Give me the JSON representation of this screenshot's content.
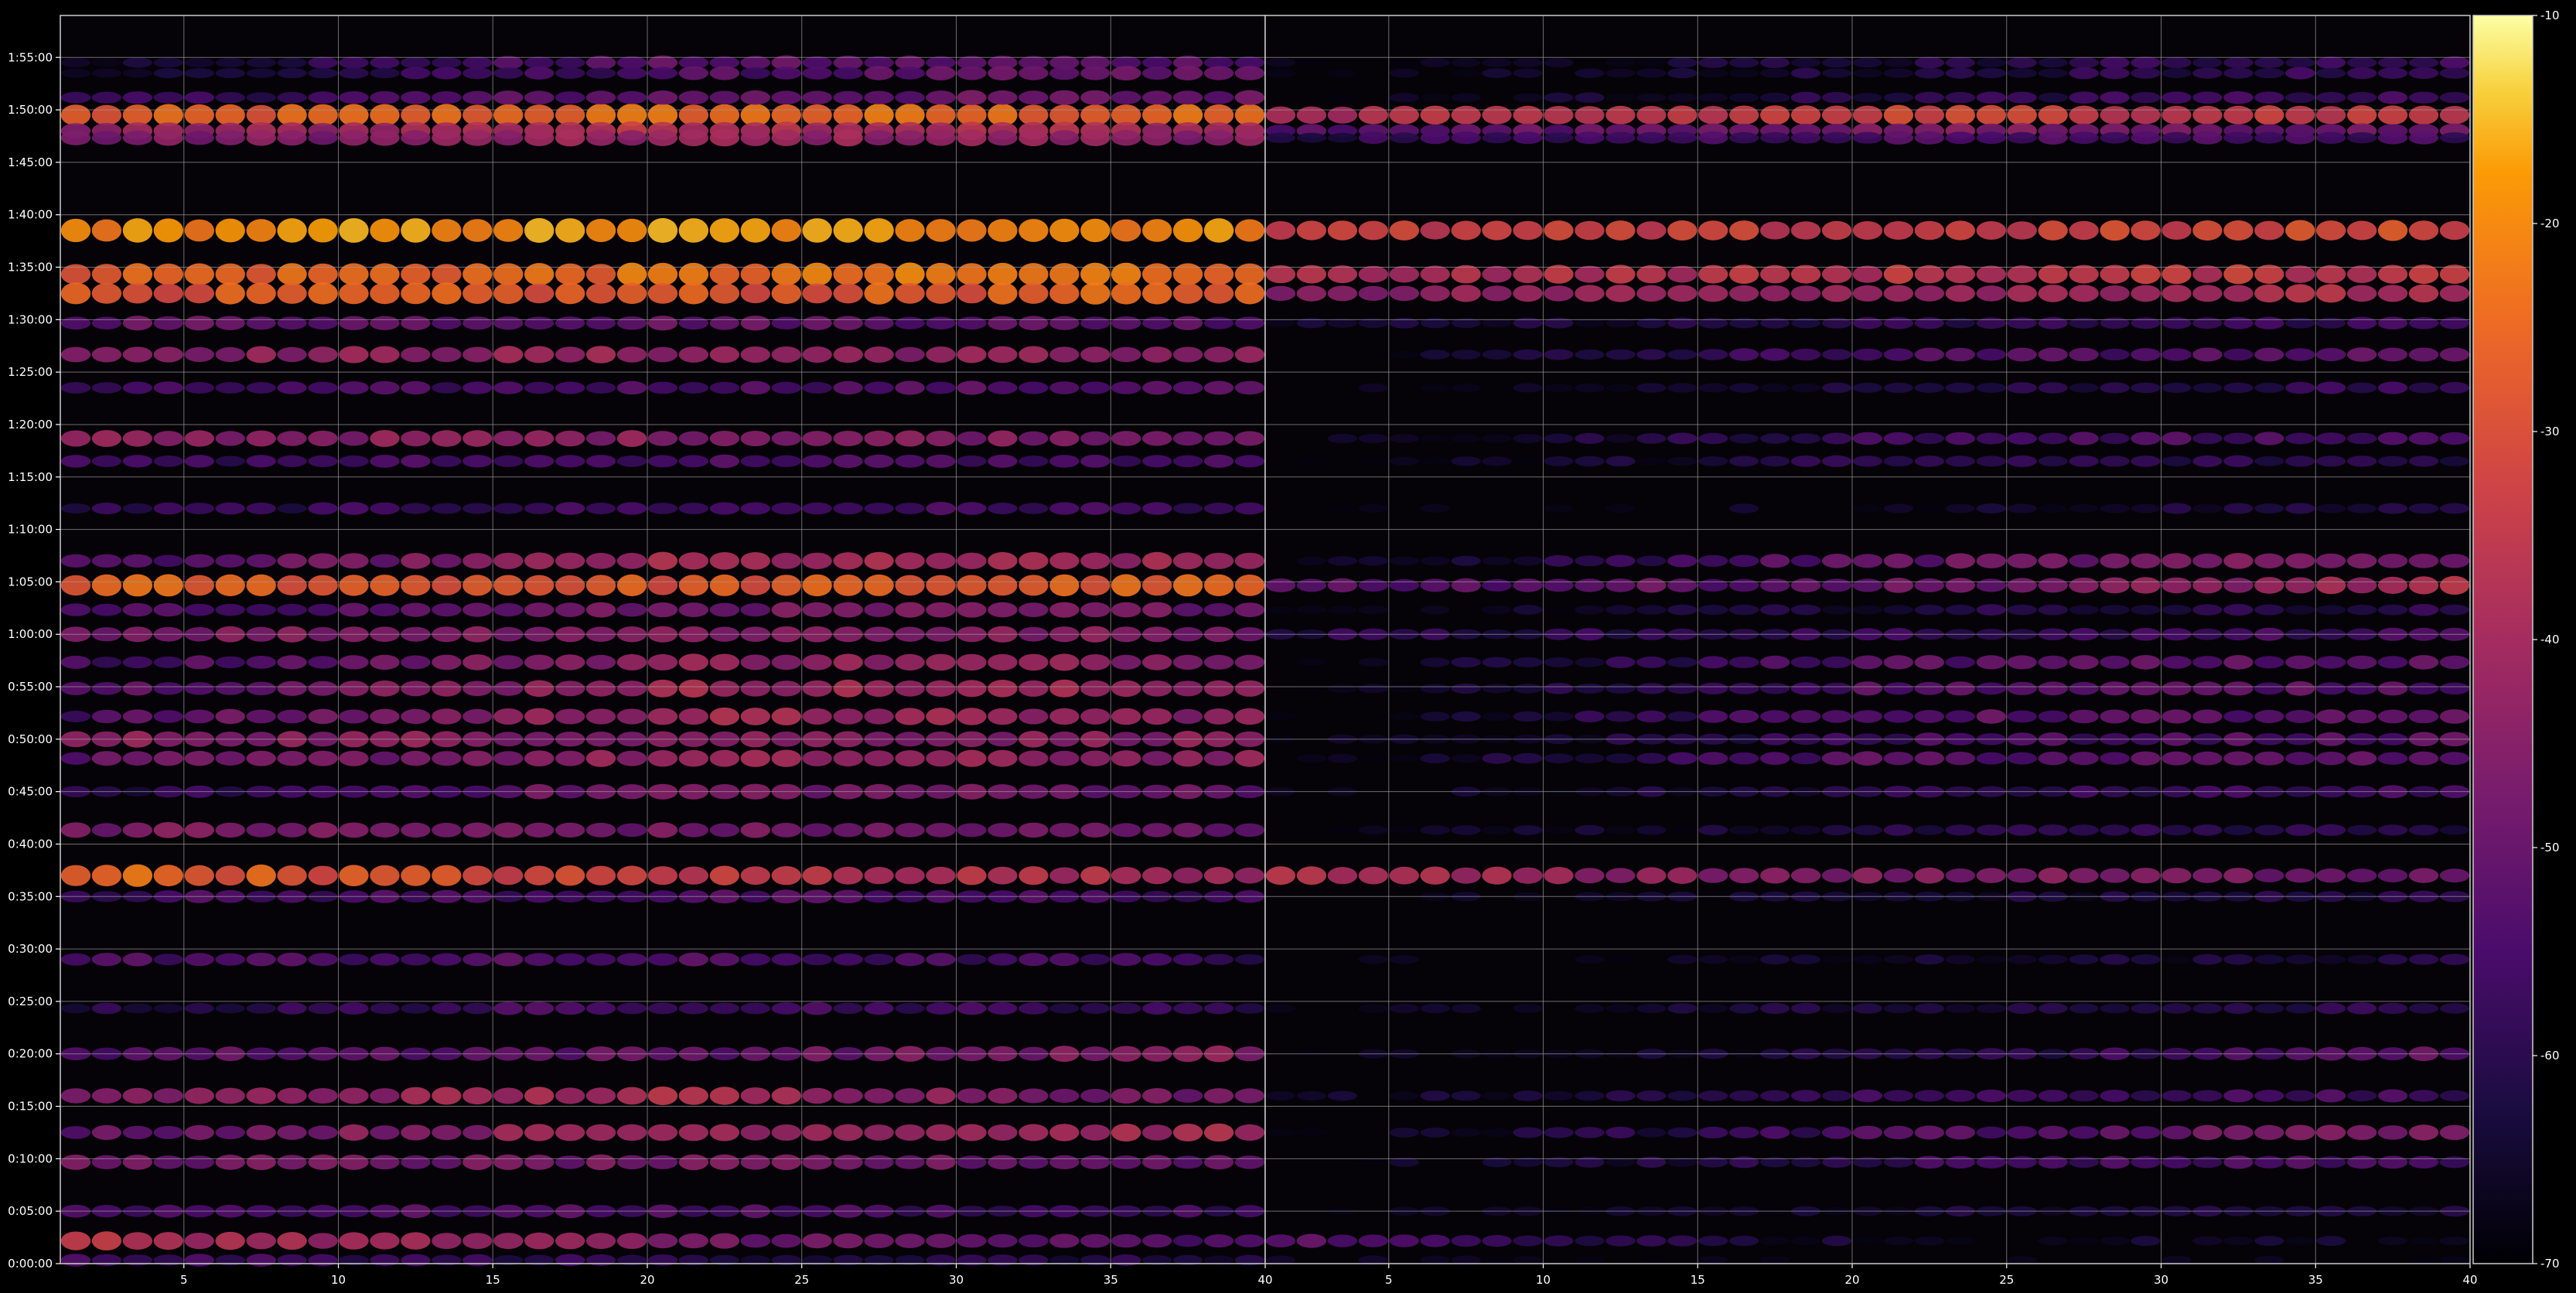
{
  "chart_data": {
    "type": "heatmap",
    "title": "",
    "xlabel": "",
    "ylabel": "",
    "colormap": "inferno",
    "background": "#000000",
    "grid": true,
    "grid_color": "#9a9a9a",
    "panels": [
      {
        "name": "",
        "xlim": [
          1,
          40
        ],
        "x_ticks": [
          5,
          10,
          15,
          20,
          25,
          30,
          35,
          40
        ]
      },
      {
        "name": "",
        "xlim": [
          1,
          40
        ],
        "x_ticks": [
          5,
          10,
          15,
          20,
          25,
          30,
          35,
          40
        ]
      }
    ],
    "y_axis": {
      "min_seconds": 0,
      "max_seconds": 7140,
      "tick_labels": [
        "0:00:00",
        "0:05:00",
        "0:10:00",
        "0:15:00",
        "0:20:00",
        "0:25:00",
        "0:30:00",
        "0:35:00",
        "0:40:00",
        "0:45:00",
        "0:50:00",
        "0:55:00",
        "1:00:00",
        "1:05:00",
        "1:10:00",
        "1:15:00",
        "1:20:00",
        "1:25:00",
        "1:30:00",
        "1:35:00",
        "1:40:00",
        "1:45:00",
        "1:50:00",
        "1:55:00"
      ]
    },
    "colorbar": {
      "min": -70,
      "max": -10,
      "tick_labels": [
        "-10",
        "-20",
        "-30",
        "-40",
        "-50",
        "-60",
        "-70"
      ],
      "tick_values": [
        -10,
        -20,
        -30,
        -40,
        -50,
        -60,
        -70
      ]
    },
    "bands": [
      {
        "t": 6570,
        "a": [
          -28,
          -24,
          -26
        ],
        "b": [
          -40,
          -32,
          -34
        ]
      },
      {
        "t": 6480,
        "a": [
          -44,
          -36,
          -40
        ],
        "b": [
          -54,
          -46,
          -50
        ]
      },
      {
        "t": 6440,
        "a": [
          -48,
          -42,
          -44
        ],
        "b": [
          -60,
          -54,
          -56
        ]
      },
      {
        "t": 6670,
        "a": [
          -60,
          -50,
          -50
        ],
        "b": [
          -70,
          -60,
          -56
        ]
      },
      {
        "t": 6870,
        "a": [
          -64,
          -52,
          -52
        ],
        "b": [
          -70,
          -62,
          -56
        ]
      },
      {
        "t": 6810,
        "a": [
          -66,
          -54,
          -50
        ],
        "b": [
          -70,
          -62,
          -56
        ]
      },
      {
        "t": 5910,
        "a": [
          -20,
          -18,
          -20
        ],
        "b": [
          -34,
          -34,
          -30
        ]
      },
      {
        "t": 5660,
        "a": [
          -26,
          -24,
          -22
        ],
        "b": [
          -38,
          -36,
          -34
        ]
      },
      {
        "t": 5550,
        "a": [
          -28,
          -28,
          -26
        ],
        "b": [
          -44,
          -40,
          -38
        ]
      },
      {
        "t": 5380,
        "a": [
          -50,
          -50,
          -52
        ],
        "b": [
          -66,
          -60,
          -56
        ]
      },
      {
        "t": 5200,
        "a": [
          -44,
          -42,
          -44
        ],
        "b": [
          -70,
          -54,
          -52
        ]
      },
      {
        "t": 5010,
        "a": [
          -58,
          -54,
          -52
        ],
        "b": [
          -70,
          -62,
          -58
        ]
      },
      {
        "t": 4720,
        "a": [
          -44,
          -44,
          -46
        ],
        "b": [
          -70,
          -56,
          -54
        ]
      },
      {
        "t": 4590,
        "a": [
          -58,
          -54,
          -56
        ],
        "b": [
          -70,
          -60,
          -60
        ]
      },
      {
        "t": 4320,
        "a": [
          -60,
          -56,
          -56
        ],
        "b": [
          -70,
          -66,
          -60
        ]
      },
      {
        "t": 4020,
        "a": [
          -56,
          -40,
          -42
        ],
        "b": [
          -70,
          -50,
          -46
        ]
      },
      {
        "t": 3880,
        "a": [
          -26,
          -28,
          -26
        ],
        "b": [
          -52,
          -50,
          -38
        ]
      },
      {
        "t": 3740,
        "a": [
          -56,
          -48,
          -48
        ],
        "b": [
          -70,
          -62,
          -60
        ]
      },
      {
        "t": 3600,
        "a": [
          -46,
          -44,
          -46
        ],
        "b": [
          -60,
          -58,
          -56
        ]
      },
      {
        "t": 3440,
        "a": [
          -56,
          -42,
          -44
        ],
        "b": [
          -70,
          -52,
          -52
        ]
      },
      {
        "t": 3290,
        "a": [
          -52,
          -40,
          -42
        ],
        "b": [
          -70,
          -52,
          -52
        ]
      },
      {
        "t": 3130,
        "a": [
          -54,
          -40,
          -44
        ],
        "b": [
          -70,
          -52,
          -52
        ]
      },
      {
        "t": 3000,
        "a": [
          -44,
          -44,
          -44
        ],
        "b": [
          -70,
          -56,
          -52
        ]
      },
      {
        "t": 2890,
        "a": [
          -52,
          -42,
          -44
        ],
        "b": [
          -70,
          -52,
          -52
        ]
      },
      {
        "t": 2700,
        "a": [
          -62,
          -46,
          -50
        ],
        "b": [
          -70,
          -60,
          -56
        ]
      },
      {
        "t": 2480,
        "a": [
          -46,
          -48,
          -50
        ],
        "b": [
          -70,
          -62,
          -60
        ]
      },
      {
        "t": 2220,
        "a": [
          -24,
          -34,
          -40
        ],
        "b": [
          -38,
          -46,
          -48
        ]
      },
      {
        "t": 2100,
        "a": [
          -56,
          -54,
          -56
        ],
        "b": [
          -70,
          -64,
          -60
        ]
      },
      {
        "t": 1740,
        "a": [
          -54,
          -54,
          -58
        ],
        "b": [
          -70,
          -66,
          -62
        ]
      },
      {
        "t": 1460,
        "a": [
          -62,
          -54,
          -60
        ],
        "b": [
          -70,
          -62,
          -60
        ]
      },
      {
        "t": 1200,
        "a": [
          -52,
          -50,
          -44
        ],
        "b": [
          -70,
          -62,
          -50
        ]
      },
      {
        "t": 960,
        "a": [
          -46,
          -38,
          -50
        ],
        "b": [
          -68,
          -56,
          -56
        ]
      },
      {
        "t": 750,
        "a": [
          -50,
          -40,
          -40
        ],
        "b": [
          -70,
          -54,
          -46
        ]
      },
      {
        "t": 580,
        "a": [
          -48,
          -48,
          -50
        ],
        "b": [
          -70,
          -58,
          -54
        ]
      },
      {
        "t": 300,
        "a": [
          -54,
          -54,
          -58
        ],
        "b": [
          -70,
          -64,
          -62
        ]
      },
      {
        "t": 130,
        "a": [
          -36,
          -46,
          -56
        ],
        "b": [
          -52,
          -66,
          -66
        ]
      },
      {
        "t": 20,
        "a": [
          -56,
          -60,
          -62
        ],
        "b": [
          -66,
          -70,
          -70
        ]
      }
    ]
  }
}
